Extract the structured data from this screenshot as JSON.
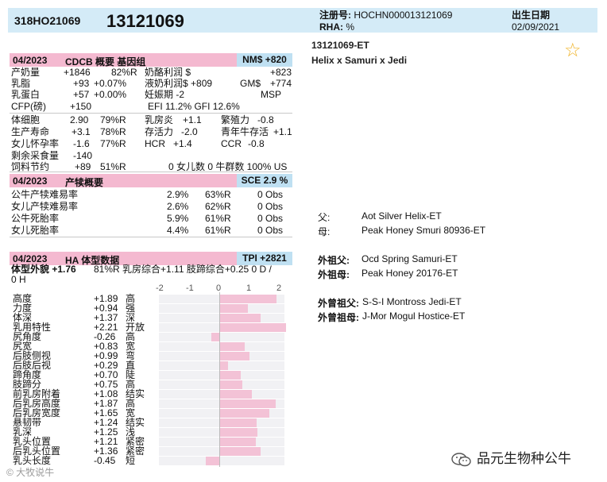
{
  "header": {
    "id_code": "318HO21069",
    "number": "13121069",
    "reg_label": "注册号:",
    "reg_value": "HOCHN000013121069",
    "rha_label": "RHA:",
    "rha_value": "%",
    "birth_label": "出生日期",
    "birth_value": "02/09/2021"
  },
  "right": {
    "code": "13121069-ET",
    "pedigree_name": "Helix x Samuri x Jedi"
  },
  "section1": {
    "date": "04/2023",
    "title": "CDCB 概要 基因组",
    "badge": "NM$ +820"
  },
  "s1": {
    "r1": [
      "产奶量",
      "+1846",
      "82%R",
      "奶酪利润 $",
      "+823"
    ],
    "r2": [
      "乳脂",
      "+93",
      "+0.07%",
      "液奶利润$ +809",
      "GM$",
      "+774"
    ],
    "r3": [
      "乳蛋白",
      "+57",
      "+0.00%",
      "妊娠期 -2",
      "MSP"
    ],
    "r4": [
      "CFP(磅)",
      "+150",
      "EFI 11.2% GFI 12.6%"
    ],
    "r5": [
      "体细胞",
      "2.90",
      "79%R",
      "乳房炎",
      "+1.1",
      "繁殖力",
      "-0.8"
    ],
    "r6": [
      "生产寿命",
      "+3.1",
      "78%R",
      "存活力",
      "-2.0",
      "青年牛存活",
      "+1.1"
    ],
    "r7": [
      "女儿怀孕率",
      "-1.6",
      "77%R",
      "HCR",
      "+1.4",
      "CCR",
      "-0.8"
    ],
    "r8": [
      "剩余采食量",
      "-140"
    ],
    "r9": [
      "饲料节约",
      "+89",
      "51%R",
      "0 女儿数 0 牛群数 100% US"
    ]
  },
  "section2": {
    "date": "04/2023",
    "title": "产犊概要",
    "badge": "SCE 2.9 %"
  },
  "s2": [
    [
      "公牛产犊难易率",
      "2.9%",
      "63%R",
      "0 Obs"
    ],
    [
      "女儿产犊难易率",
      "2.6%",
      "62%R",
      "0 Obs"
    ],
    [
      "公牛死胎率",
      "5.9%",
      "61%R",
      "0 Obs"
    ],
    [
      "女儿死胎率",
      "4.4%",
      "61%R",
      "0 Obs"
    ]
  ],
  "section3": {
    "date": "04/2023",
    "title": "HA 体型数据",
    "badge": "TPI +2821",
    "summary_label": "体型外貌 +1.76",
    "summary_rest": "81%R 乳房综合+1.11 肢蹄综合+0.25 0 D /",
    "summary_line2": "0 H",
    "axis": [
      "-2",
      "-1",
      "0",
      "1",
      "2"
    ]
  },
  "traits": [
    {
      "name": "高度",
      "value": "+1.89",
      "desc": "高",
      "v": 1.89
    },
    {
      "name": "力度",
      "value": "+0.94",
      "desc": "强",
      "v": 0.94
    },
    {
      "name": "体深",
      "value": "+1.37",
      "desc": "深",
      "v": 1.37
    },
    {
      "name": "乳用特性",
      "value": "+2.21",
      "desc": "开放",
      "v": 2.21
    },
    {
      "name": "尻角度",
      "value": "-0.26",
      "desc": "高",
      "v": -0.26
    },
    {
      "name": "尻宽",
      "value": "+0.83",
      "desc": "宽",
      "v": 0.83
    },
    {
      "name": "后肢侧视",
      "value": "+0.99",
      "desc": "弯",
      "v": 0.99
    },
    {
      "name": "后肢后视",
      "value": "+0.29",
      "desc": "直",
      "v": 0.29
    },
    {
      "name": "蹄角度",
      "value": "+0.70",
      "desc": "陡",
      "v": 0.7
    },
    {
      "name": "肢蹄分",
      "value": "+0.75",
      "desc": "高",
      "v": 0.75
    },
    {
      "name": "前乳房附着",
      "value": "+1.08",
      "desc": "结实",
      "v": 1.08
    },
    {
      "name": "后乳房高度",
      "value": "+1.87",
      "desc": "高",
      "v": 1.87
    },
    {
      "name": "后乳房宽度",
      "value": "+1.65",
      "desc": "宽",
      "v": 1.65
    },
    {
      "name": "悬韧带",
      "value": "+1.24",
      "desc": "结实",
      "v": 1.24
    },
    {
      "name": "乳深",
      "value": "+1.25",
      "desc": "浅",
      "v": 1.25
    },
    {
      "name": "乳头位置",
      "value": "+1.21",
      "desc": "紧密",
      "v": 1.21
    },
    {
      "name": "后乳头位置",
      "value": "+1.36",
      "desc": "紧密",
      "v": 1.36
    },
    {
      "name": "乳头长度",
      "value": "-0.45",
      "desc": "短",
      "v": -0.45
    }
  ],
  "pedigree": {
    "sire_label": "父:",
    "sire": "Aot Silver Helix-ET",
    "dam_label": "母:",
    "dam": "Peak Honey Smuri 80936-ET",
    "mgs_label": "外祖父:",
    "mgs": "Ocd Spring Samuri-ET",
    "mgd_label": "外祖母:",
    "mgd": "Peak Honey 20176-ET",
    "mggs_label": "外曾祖父:",
    "mggs": "S-S-I Montross Jedi-ET",
    "mggd_label": "外曾祖母:",
    "mggd": "J-Mor Mogul Hostice-ET"
  },
  "footer": {
    "watermark": "© 大牧说牛",
    "brand": "品元生物种公牛"
  },
  "colors": {
    "header_bg": "#d4ebf7",
    "section_bg": "#f4b9d0",
    "badge_bg": "#bfe0f2",
    "bar_fill": "#f3c2d6",
    "star": "#f0b429"
  },
  "icons": {
    "favorite": "star-outline-icon",
    "brand": "wechat-icon"
  }
}
